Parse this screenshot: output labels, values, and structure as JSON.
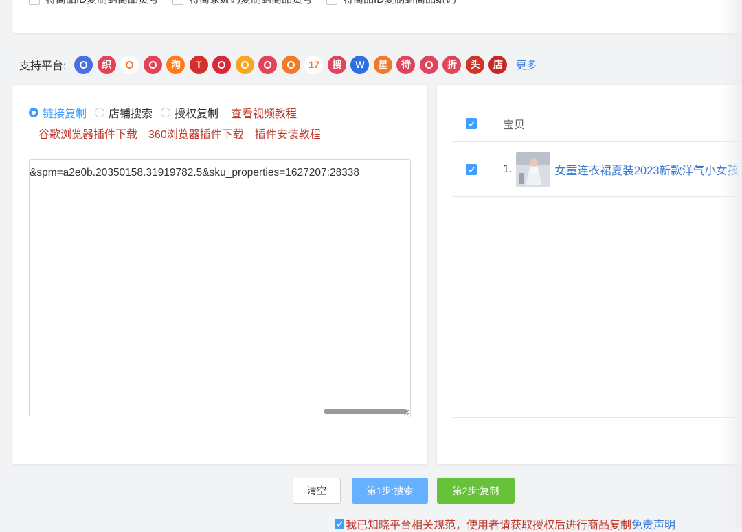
{
  "top_options": [
    {
      "label": "将商品ID复制到商品货号"
    },
    {
      "label": "将商家编码复制到商品货号"
    },
    {
      "label": "将商品ID复制到商品编码"
    }
  ],
  "platforms": {
    "label": "支持平台:",
    "items": [
      {
        "glyph": "",
        "name": "platform-circle-icon",
        "color": "#4b6fe0"
      },
      {
        "glyph": "织",
        "name": "zhi-icon",
        "color": "#e0455b"
      },
      {
        "glyph": "",
        "name": "flame-icon",
        "color": "#ffffff"
      },
      {
        "glyph": "",
        "name": "pattern-icon",
        "color": "#e0455b"
      },
      {
        "glyph": "淘",
        "name": "tao-icon",
        "color": "#ff7a1a"
      },
      {
        "glyph": "T",
        "name": "tmall-icon",
        "color": "#d32f2f"
      },
      {
        "glyph": "",
        "name": "kaola-icon",
        "color": "#d8293b"
      },
      {
        "glyph": "",
        "name": "sun-icon",
        "color": "#f5a623"
      },
      {
        "glyph": "",
        "name": "face-icon",
        "color": "#e0455b"
      },
      {
        "glyph": "",
        "name": "leaf-icon",
        "color": "#f07a2a"
      },
      {
        "glyph": "17",
        "name": "seventeen-icon",
        "color": "#ffffff"
      },
      {
        "glyph": "搜",
        "name": "sou-icon",
        "color": "#e0455b"
      },
      {
        "glyph": "W",
        "name": "w-icon",
        "color": "#2f6fe0"
      },
      {
        "glyph": "星",
        "name": "xing-icon",
        "color": "#f07a2a"
      },
      {
        "glyph": "待",
        "name": "dai-icon",
        "color": "#e0455b"
      },
      {
        "glyph": "",
        "name": "bag-icon",
        "color": "#e0455b"
      },
      {
        "glyph": "折",
        "name": "zhe-icon",
        "color": "#e0455b"
      },
      {
        "glyph": "头",
        "name": "tou-icon",
        "color": "#d0352a"
      },
      {
        "glyph": "店",
        "name": "dian-icon",
        "color": "#c62828"
      }
    ],
    "more": "更多"
  },
  "left": {
    "radios": [
      {
        "label": "链接复制",
        "selected": true
      },
      {
        "label": "店铺搜索",
        "selected": false
      },
      {
        "label": "授权复制",
        "selected": false
      }
    ],
    "video_link": "查看视频教程",
    "links": [
      "谷歌浏览器插件下载",
      "360浏览器插件下载",
      "插件安装教程"
    ],
    "textarea_value": "&spm=a2e0b.20350158.31919782.5&sku_properties=1627207:28338"
  },
  "right": {
    "header": "宝贝",
    "items": [
      {
        "index": "1.",
        "title": "女童连衣裙夏装2023新款洋气小女孩"
      }
    ]
  },
  "buttons": {
    "clear": "清空",
    "search": "第1步:搜索",
    "copy": "第2步:复制"
  },
  "agreement": {
    "text": "我已知晓平台相关规范，使用者请获取授权后进行商品复制",
    "link": "免责声明"
  }
}
